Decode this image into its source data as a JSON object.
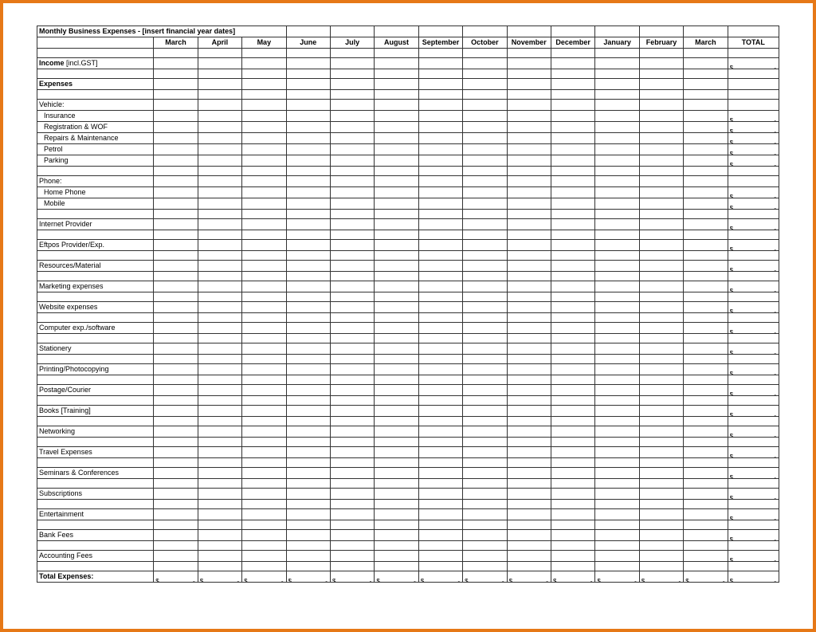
{
  "title": "Monthly Business Expenses - [insert financial year dates]",
  "months": [
    "March",
    "April",
    "May",
    "June",
    "July",
    "August",
    "September",
    "October",
    "November",
    "December",
    "January",
    "February",
    "March"
  ],
  "totalHeader": "TOTAL",
  "currency": "$",
  "dash": "-",
  "rows": [
    {
      "type": "blank"
    },
    {
      "type": "line",
      "label": "Income [incl.GST]",
      "boldPrefix": "Income",
      "rest": " [incl.GST]",
      "total": true
    },
    {
      "type": "blank"
    },
    {
      "type": "line",
      "label": "Expenses",
      "bold": true,
      "total": false
    },
    {
      "type": "blank"
    },
    {
      "type": "line",
      "label": "Vehicle:",
      "total": false
    },
    {
      "type": "line",
      "label": "Insurance",
      "indent": true,
      "total": true
    },
    {
      "type": "line",
      "label": "Registration & WOF",
      "indent": true,
      "total": true
    },
    {
      "type": "line",
      "label": "Repairs & Maintenance",
      "indent": true,
      "total": true
    },
    {
      "type": "line",
      "label": "Petrol",
      "indent": true,
      "total": true
    },
    {
      "type": "line",
      "label": "Parking",
      "indent": true,
      "total": true
    },
    {
      "type": "blank"
    },
    {
      "type": "line",
      "label": "Phone:",
      "total": false
    },
    {
      "type": "line",
      "label": "Home Phone",
      "indent": true,
      "total": true
    },
    {
      "type": "line",
      "label": "Mobile",
      "indent": true,
      "total": true
    },
    {
      "type": "blank"
    },
    {
      "type": "line",
      "label": "Internet Provider",
      "total": true
    },
    {
      "type": "blank"
    },
    {
      "type": "line",
      "label": "Eftpos Provider/Exp.",
      "total": true
    },
    {
      "type": "blank"
    },
    {
      "type": "line",
      "label": "Resources/Material",
      "total": true
    },
    {
      "type": "blank"
    },
    {
      "type": "line",
      "label": "Marketing expenses",
      "total": true
    },
    {
      "type": "blank"
    },
    {
      "type": "line",
      "label": "Website expenses",
      "total": true
    },
    {
      "type": "blank"
    },
    {
      "type": "line",
      "label": "Computer exp./software",
      "total": true
    },
    {
      "type": "blank"
    },
    {
      "type": "line",
      "label": "Stationery",
      "total": true
    },
    {
      "type": "blank"
    },
    {
      "type": "line",
      "label": "Printing/Photocopying",
      "total": true
    },
    {
      "type": "blank"
    },
    {
      "type": "line",
      "label": "Postage/Courier",
      "total": true
    },
    {
      "type": "blank"
    },
    {
      "type": "line",
      "label": "Books [Training]",
      "total": true
    },
    {
      "type": "blank"
    },
    {
      "type": "line",
      "label": "Networking",
      "total": true
    },
    {
      "type": "blank"
    },
    {
      "type": "line",
      "label": "Travel Expenses",
      "total": true
    },
    {
      "type": "blank"
    },
    {
      "type": "line",
      "label": "Seminars & Conferences",
      "total": true
    },
    {
      "type": "blank"
    },
    {
      "type": "line",
      "label": "Subscriptions",
      "total": true
    },
    {
      "type": "blank"
    },
    {
      "type": "line",
      "label": "Entertainment",
      "total": true
    },
    {
      "type": "blank"
    },
    {
      "type": "line",
      "label": "Bank Fees",
      "total": true
    },
    {
      "type": "blank"
    },
    {
      "type": "line",
      "label": "Accounting Fees",
      "total": true
    },
    {
      "type": "blank"
    },
    {
      "type": "totals",
      "label": "Total Expenses:"
    }
  ]
}
